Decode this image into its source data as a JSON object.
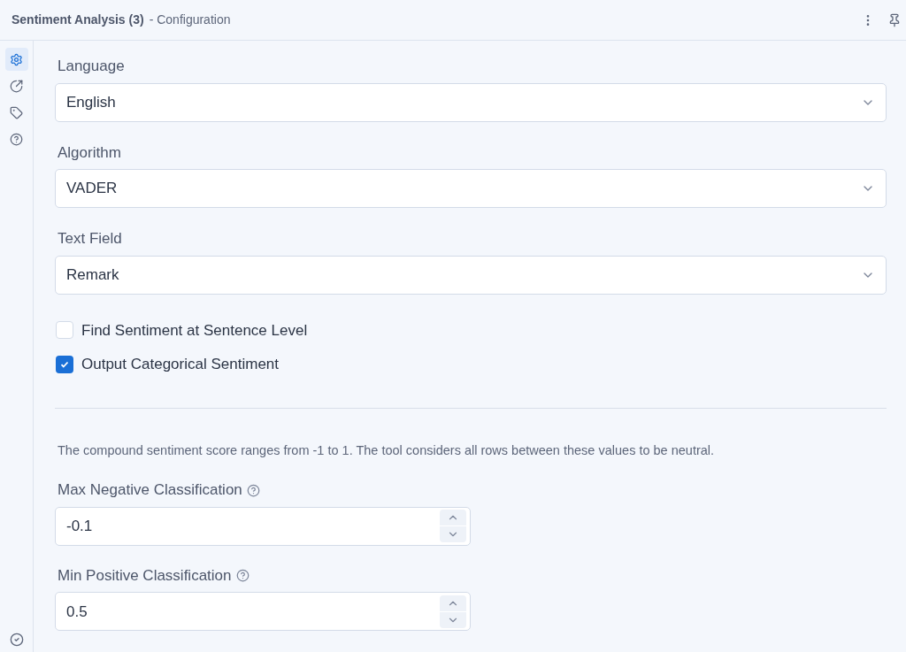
{
  "header": {
    "title": "Sentiment Analysis (3)",
    "subtitle": "- Configuration"
  },
  "sidebar": {
    "items": [
      {
        "kind": "gear",
        "selected": true
      },
      {
        "kind": "arrow",
        "selected": false
      },
      {
        "kind": "tag",
        "selected": false
      },
      {
        "kind": "help",
        "selected": false
      }
    ],
    "footer": {
      "kind": "check"
    }
  },
  "selects": [
    {
      "label": "Language",
      "value": "English"
    },
    {
      "label": "Algorithm",
      "value": "VADER"
    },
    {
      "label": "Text Field",
      "value": "Remark"
    }
  ],
  "checkboxes": [
    {
      "label": "Find Sentiment at Sentence Level",
      "checked": false
    },
    {
      "label": "Output Categorical Sentiment",
      "checked": true
    }
  ],
  "note": "The compound sentiment score ranges from -1 to 1. The tool considers all rows between these values to be neutral.",
  "numbers": [
    {
      "label": "Max Negative Classification",
      "value": "-0.1"
    },
    {
      "label": "Min Positive Classification",
      "value": "0.5"
    }
  ]
}
